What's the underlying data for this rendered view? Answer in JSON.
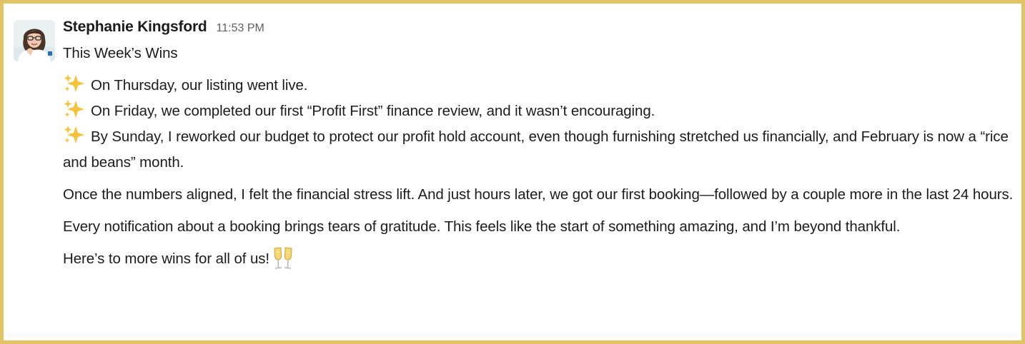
{
  "message": {
    "author": "Stephanie Kingsford",
    "timestamp": "11:53 PM",
    "title": "This Week’s Wins",
    "wins": [
      "On Thursday, our listing went live.",
      "On Friday, we completed our first “Profit First” finance review, and it wasn’t encouraging.",
      "By Sunday, I reworked our budget to protect our profit hold account, even though furnishing stretched us financially, and February is now a “rice and beans” month."
    ],
    "paragraphs": [
      "Once the numbers aligned, I felt the financial stress lift. And just hours later, we got our first booking—followed by a couple more in the last 24 hours.",
      "Every notification about a booking brings tears of gratitude. This feels like the start of something amazing, and I’m beyond thankful."
    ],
    "closing": "Here’s to more wins for all of us!",
    "emoji": {
      "bullet": "sparkles-emoji",
      "closing": "clinking-glasses-emoji"
    }
  },
  "colors": {
    "frame": "#e2c466",
    "text": "#1d1c1d",
    "timestamp": "#616061",
    "sparkle": "#f5c33b"
  }
}
